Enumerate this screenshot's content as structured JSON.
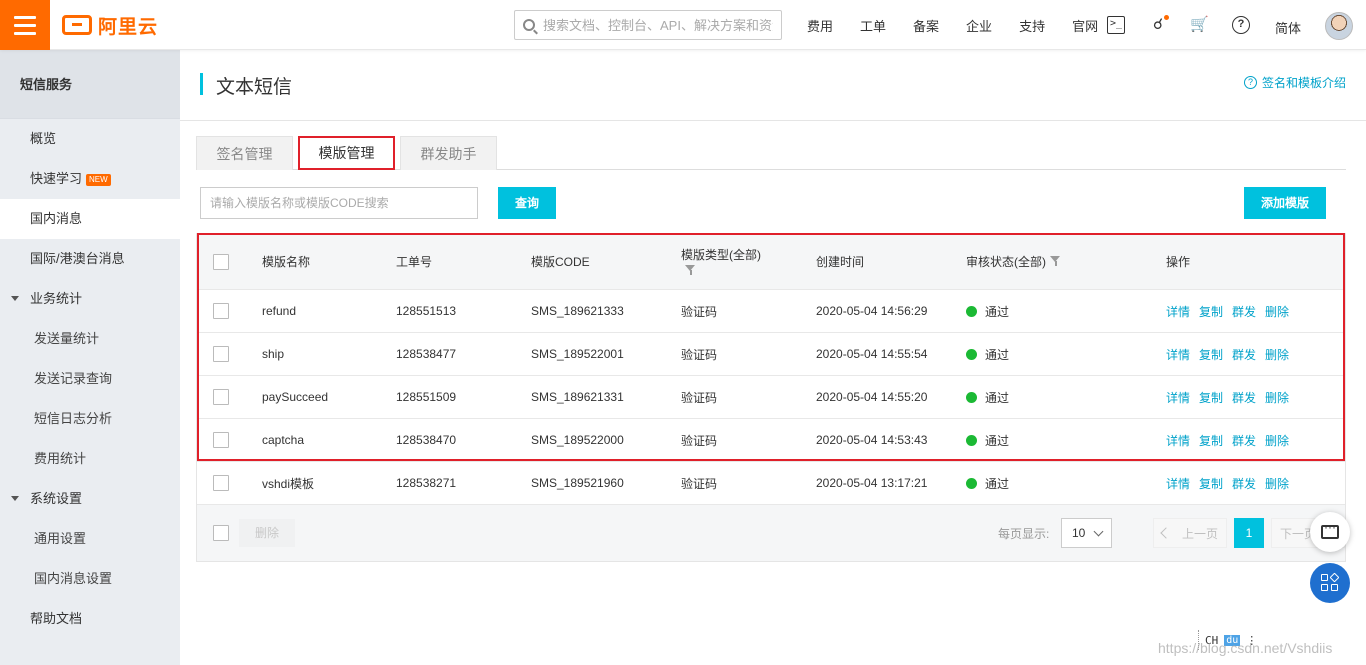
{
  "topbar": {
    "logo_text": "阿里云",
    "search_placeholder": "搜索文档、控制台、API、解决方案和资源",
    "nav": [
      "费用",
      "工单",
      "备案",
      "企业",
      "支持",
      "官网"
    ],
    "language": "简体",
    "icons": [
      "menu-icon",
      "terminal-icon",
      "bell-icon",
      "cart-icon",
      "help-icon",
      "avatar"
    ]
  },
  "sidebar": {
    "title": "短信服务",
    "items": [
      {
        "label": "概览"
      },
      {
        "label": "快速学习",
        "badge": "NEW"
      },
      {
        "label": "国内消息"
      },
      {
        "label": "国际/港澳台消息"
      },
      {
        "label": "业务统计"
      },
      {
        "label": "发送量统计"
      },
      {
        "label": "发送记录查询"
      },
      {
        "label": "短信日志分析"
      },
      {
        "label": "费用统计"
      },
      {
        "label": "系统设置"
      },
      {
        "label": "通用设置"
      },
      {
        "label": "国内消息设置"
      },
      {
        "label": "帮助文档"
      }
    ]
  },
  "page": {
    "title": "文本短信",
    "help_link": "签名和模板介绍",
    "tabs": [
      "签名管理",
      "模版管理",
      "群发助手"
    ],
    "search_placeholder": "请输入模版名称或模版CODE搜索",
    "query_button": "查询",
    "add_button": "添加模版"
  },
  "table": {
    "headers": {
      "name": "模版名称",
      "order_no": "工单号",
      "code": "模版CODE",
      "type": "模版类型(全部)",
      "created": "创建时间",
      "status": "审核状态(全部)",
      "ops": "操作"
    },
    "rows": [
      {
        "name": "refund",
        "order_no": "128551513",
        "code": "SMS_189621333",
        "type": "验证码",
        "created": "2020-05-04 14:56:29",
        "status": "通过"
      },
      {
        "name": "ship",
        "order_no": "128538477",
        "code": "SMS_189522001",
        "type": "验证码",
        "created": "2020-05-04 14:55:54",
        "status": "通过"
      },
      {
        "name": "paySucceed",
        "order_no": "128551509",
        "code": "SMS_189621331",
        "type": "验证码",
        "created": "2020-05-04 14:55:20",
        "status": "通过"
      },
      {
        "name": "captcha",
        "order_no": "128538470",
        "code": "SMS_189522000",
        "type": "验证码",
        "created": "2020-05-04 14:53:43",
        "status": "通过"
      },
      {
        "name": "vshdi模板",
        "order_no": "128538271",
        "code": "SMS_189521960",
        "type": "验证码",
        "created": "2020-05-04 13:17:21",
        "status": "通过"
      }
    ],
    "ops": [
      "详情",
      "复制",
      "群发",
      "删除"
    ],
    "status_color": "#1bb934"
  },
  "footer": {
    "delete_button": "删除",
    "per_page_label": "每页显示:",
    "per_page_value": "10",
    "prev": "上一页",
    "page": "1",
    "next": "下一页"
  },
  "ime": {
    "ch": "CH",
    "du": "du"
  },
  "watermark": "https://blog.csdn.net/Vshdiis",
  "colors": {
    "brand": "#ff6a00",
    "accent": "#00c1de",
    "link": "#00a2ca",
    "highlight": "#e0202a"
  }
}
